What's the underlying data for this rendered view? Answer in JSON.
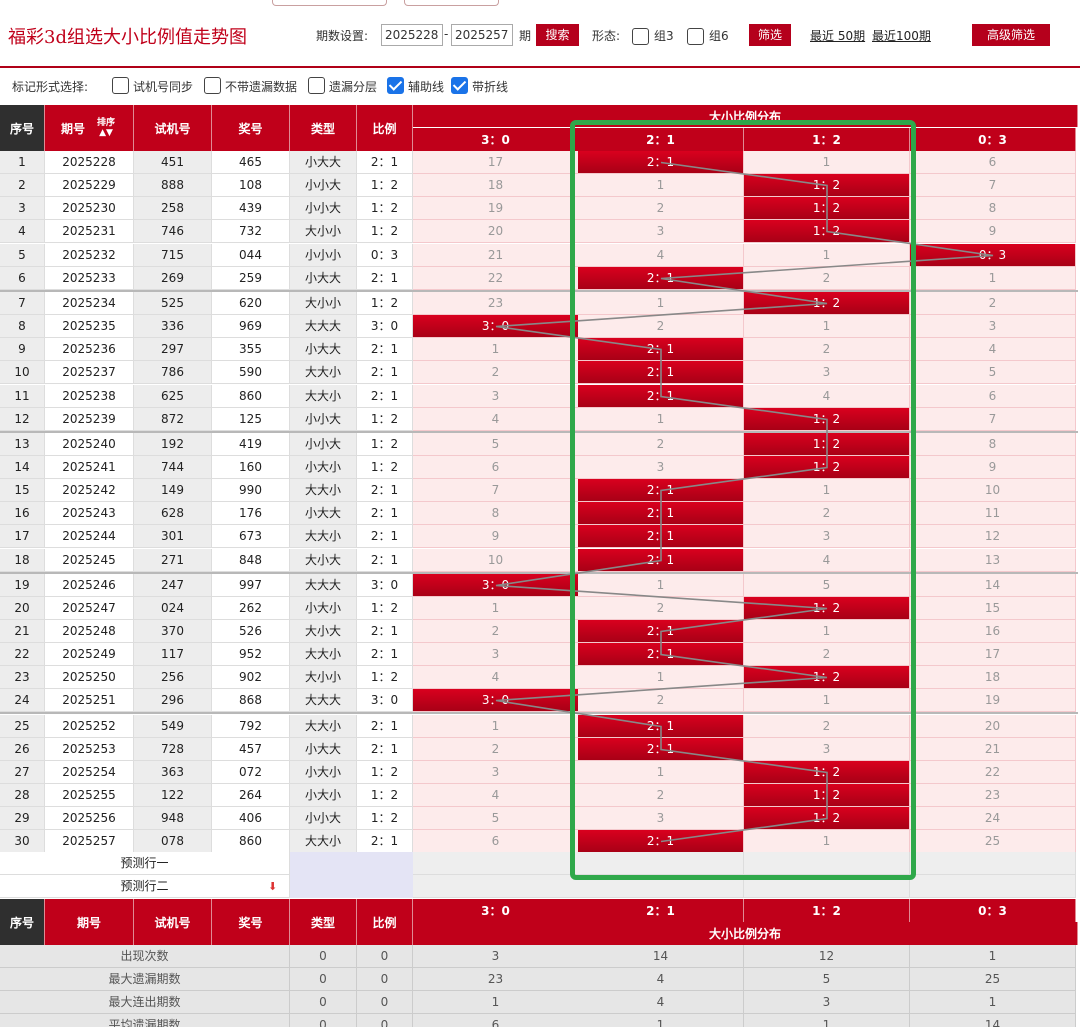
{
  "header": {
    "title": "福彩3d组选大小比例值走势图",
    "period_label": "期数设置:",
    "period_from": "2025228",
    "period_sep": "-",
    "period_to": "2025257",
    "period_unit": "期",
    "search_label": "搜索",
    "form_label": "形态:",
    "group3_label": "组3",
    "group6_label": "组6",
    "filter_label": "筛选",
    "recent50_label": "最近 50期",
    "recent100_label": "最近100期",
    "advanced_label": "高级筛选"
  },
  "markbar": {
    "label": "标记形式选择:",
    "options": [
      {
        "label": "试机号同步",
        "checked": false
      },
      {
        "label": "不带遗漏数据",
        "checked": false
      },
      {
        "label": "遗漏分层",
        "checked": false
      },
      {
        "label": "辅助线",
        "checked": true
      },
      {
        "label": "带折线",
        "checked": true
      }
    ]
  },
  "table": {
    "headers": {
      "seq": "序号",
      "period": "期号",
      "sort": "排序",
      "test": "试机号",
      "prize": "奖号",
      "type": "类型",
      "ratio": "比例",
      "dist": "大小比例分布"
    },
    "dist_cols": [
      "3：0",
      "2：1",
      "1：2",
      "0：3"
    ],
    "rows": [
      {
        "seq": "1",
        "period": "2025228",
        "test": "451",
        "prize": "465",
        "type": "小大大",
        "ratio": "2：1",
        "hit": 1,
        "z": [
          "17",
          "2：1",
          "1",
          "6"
        ]
      },
      {
        "seq": "2",
        "period": "2025229",
        "test": "888",
        "prize": "108",
        "type": "小小大",
        "ratio": "1：2",
        "hit": 2,
        "z": [
          "18",
          "1",
          "1：2",
          "7"
        ]
      },
      {
        "seq": "3",
        "period": "2025230",
        "test": "258",
        "prize": "439",
        "type": "小小大",
        "ratio": "1：2",
        "hit": 2,
        "z": [
          "19",
          "2",
          "1：2",
          "8"
        ]
      },
      {
        "seq": "4",
        "period": "2025231",
        "test": "746",
        "prize": "732",
        "type": "大小小",
        "ratio": "1：2",
        "hit": 2,
        "z": [
          "20",
          "3",
          "1：2",
          "9"
        ]
      },
      {
        "seq": "5",
        "period": "2025232",
        "test": "715",
        "prize": "044",
        "type": "小小小",
        "ratio": "0：3",
        "hit": 3,
        "z": [
          "21",
          "4",
          "1",
          "0：3"
        ]
      },
      {
        "seq": "6",
        "period": "2025233",
        "test": "269",
        "prize": "259",
        "type": "小大大",
        "ratio": "2：1",
        "hit": 1,
        "z": [
          "22",
          "2：1",
          "2",
          "1"
        ]
      },
      {
        "seq": "7",
        "period": "2025234",
        "test": "525",
        "prize": "620",
        "type": "大小小",
        "ratio": "1：2",
        "hit": 2,
        "z": [
          "23",
          "1",
          "1：2",
          "2"
        ]
      },
      {
        "seq": "8",
        "period": "2025235",
        "test": "336",
        "prize": "969",
        "type": "大大大",
        "ratio": "3：0",
        "hit": 0,
        "z": [
          "3：0",
          "2",
          "1",
          "3"
        ]
      },
      {
        "seq": "9",
        "period": "2025236",
        "test": "297",
        "prize": "355",
        "type": "小大大",
        "ratio": "2：1",
        "hit": 1,
        "z": [
          "1",
          "2：1",
          "2",
          "4"
        ]
      },
      {
        "seq": "10",
        "period": "2025237",
        "test": "786",
        "prize": "590",
        "type": "大大小",
        "ratio": "2：1",
        "hit": 1,
        "z": [
          "2",
          "2：1",
          "3",
          "5"
        ]
      },
      {
        "seq": "11",
        "period": "2025238",
        "test": "625",
        "prize": "860",
        "type": "大大小",
        "ratio": "2：1",
        "hit": 1,
        "z": [
          "3",
          "2：1",
          "4",
          "6"
        ]
      },
      {
        "seq": "12",
        "period": "2025239",
        "test": "872",
        "prize": "125",
        "type": "小小大",
        "ratio": "1：2",
        "hit": 2,
        "z": [
          "4",
          "1",
          "1：2",
          "7"
        ]
      },
      {
        "seq": "13",
        "period": "2025240",
        "test": "192",
        "prize": "419",
        "type": "小小大",
        "ratio": "1：2",
        "hit": 2,
        "z": [
          "5",
          "2",
          "1：2",
          "8"
        ]
      },
      {
        "seq": "14",
        "period": "2025241",
        "test": "744",
        "prize": "160",
        "type": "小大小",
        "ratio": "1：2",
        "hit": 2,
        "z": [
          "6",
          "3",
          "1：2",
          "9"
        ]
      },
      {
        "seq": "15",
        "period": "2025242",
        "test": "149",
        "prize": "990",
        "type": "大大小",
        "ratio": "2：1",
        "hit": 1,
        "z": [
          "7",
          "2：1",
          "1",
          "10"
        ]
      },
      {
        "seq": "16",
        "period": "2025243",
        "test": "628",
        "prize": "176",
        "type": "小大大",
        "ratio": "2：1",
        "hit": 1,
        "z": [
          "8",
          "2：1",
          "2",
          "11"
        ]
      },
      {
        "seq": "17",
        "period": "2025244",
        "test": "301",
        "prize": "673",
        "type": "大大小",
        "ratio": "2：1",
        "hit": 1,
        "z": [
          "9",
          "2：1",
          "3",
          "12"
        ]
      },
      {
        "seq": "18",
        "period": "2025245",
        "test": "271",
        "prize": "848",
        "type": "大小大",
        "ratio": "2：1",
        "hit": 1,
        "z": [
          "10",
          "2：1",
          "4",
          "13"
        ]
      },
      {
        "seq": "19",
        "period": "2025246",
        "test": "247",
        "prize": "997",
        "type": "大大大",
        "ratio": "3：0",
        "hit": 0,
        "z": [
          "3：0",
          "1",
          "5",
          "14"
        ]
      },
      {
        "seq": "20",
        "period": "2025247",
        "test": "024",
        "prize": "262",
        "type": "小大小",
        "ratio": "1：2",
        "hit": 2,
        "z": [
          "1",
          "2",
          "1：2",
          "15"
        ]
      },
      {
        "seq": "21",
        "period": "2025248",
        "test": "370",
        "prize": "526",
        "type": "大小大",
        "ratio": "2：1",
        "hit": 1,
        "z": [
          "2",
          "2：1",
          "1",
          "16"
        ]
      },
      {
        "seq": "22",
        "period": "2025249",
        "test": "117",
        "prize": "952",
        "type": "大大小",
        "ratio": "2：1",
        "hit": 1,
        "z": [
          "3",
          "2：1",
          "2",
          "17"
        ]
      },
      {
        "seq": "23",
        "period": "2025250",
        "test": "256",
        "prize": "902",
        "type": "大小小",
        "ratio": "1：2",
        "hit": 2,
        "z": [
          "4",
          "1",
          "1：2",
          "18"
        ]
      },
      {
        "seq": "24",
        "period": "2025251",
        "test": "296",
        "prize": "868",
        "type": "大大大",
        "ratio": "3：0",
        "hit": 0,
        "z": [
          "3：0",
          "2",
          "1",
          "19"
        ]
      },
      {
        "seq": "25",
        "period": "2025252",
        "test": "549",
        "prize": "792",
        "type": "大大小",
        "ratio": "2：1",
        "hit": 1,
        "z": [
          "1",
          "2：1",
          "2",
          "20"
        ]
      },
      {
        "seq": "26",
        "period": "2025253",
        "test": "728",
        "prize": "457",
        "type": "小大大",
        "ratio": "2：1",
        "hit": 1,
        "z": [
          "2",
          "2：1",
          "3",
          "21"
        ]
      },
      {
        "seq": "27",
        "period": "2025254",
        "test": "363",
        "prize": "072",
        "type": "小大小",
        "ratio": "1：2",
        "hit": 2,
        "z": [
          "3",
          "1",
          "1：2",
          "22"
        ]
      },
      {
        "seq": "28",
        "period": "2025255",
        "test": "122",
        "prize": "264",
        "type": "小大小",
        "ratio": "1：2",
        "hit": 2,
        "z": [
          "4",
          "2",
          "1：2",
          "23"
        ]
      },
      {
        "seq": "29",
        "period": "2025256",
        "test": "948",
        "prize": "406",
        "type": "小小大",
        "ratio": "1：2",
        "hit": 2,
        "z": [
          "5",
          "3",
          "1：2",
          "24"
        ]
      },
      {
        "seq": "30",
        "period": "2025257",
        "test": "078",
        "prize": "860",
        "type": "大大小",
        "ratio": "2：1",
        "hit": 1,
        "z": [
          "6",
          "2：1",
          "1",
          "25"
        ]
      }
    ],
    "predict1": "预测行一",
    "predict2": "预测行二",
    "stats": [
      {
        "label": "出现次数",
        "type": "0",
        "ratio": "0",
        "v": [
          "3",
          "14",
          "12",
          "1"
        ]
      },
      {
        "label": "最大遗漏期数",
        "type": "0",
        "ratio": "0",
        "v": [
          "23",
          "4",
          "5",
          "25"
        ]
      },
      {
        "label": "最大连出期数",
        "type": "0",
        "ratio": "0",
        "v": [
          "1",
          "4",
          "3",
          "1"
        ]
      },
      {
        "label": "平均遗漏期数",
        "type": "0",
        "ratio": "0",
        "v": [
          "6",
          "1",
          "1",
          "14"
        ]
      }
    ]
  },
  "colors": {
    "accent": "#c0001a",
    "highlight": "#2fa84a",
    "miss_bg": "#fdebeb"
  }
}
